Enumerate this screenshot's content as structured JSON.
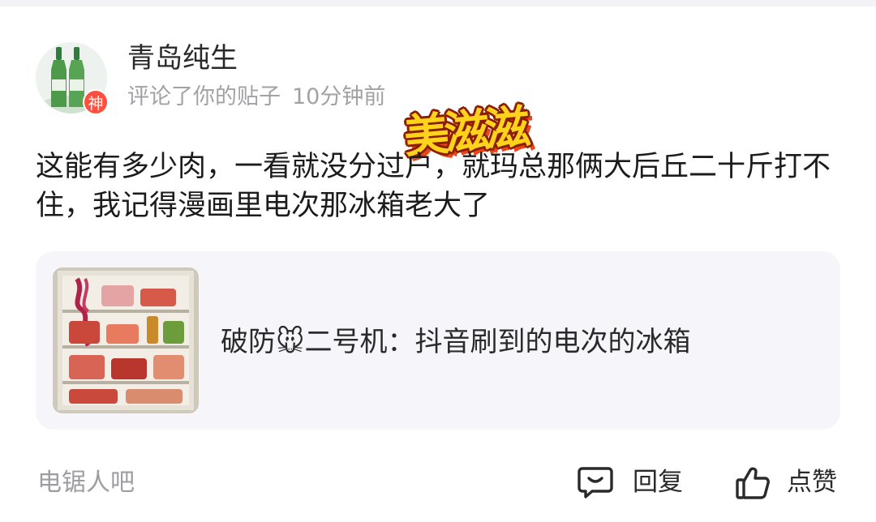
{
  "user": {
    "name": "青岛纯生",
    "badge": "神",
    "action_text": "评论了你的贴子",
    "time": "10分钟前"
  },
  "sticker": {
    "text": "美滋滋"
  },
  "comment": {
    "text": "这能有多少肉，一看就没分过户，就玛总那俩大后丘二十斤打不住，我记得漫画里电次那冰箱老大了"
  },
  "quoted_post": {
    "text": "破防🐭二号机：抖音刷到的电次的冰箱"
  },
  "footer": {
    "forum": "电锯人吧",
    "reply_label": "回复",
    "like_label": "点赞"
  },
  "colors": {
    "badge": "#ff4f3f",
    "card_bg": "#f6f5fa",
    "muted_text": "#a2a2a6",
    "sticker_fill": "#ffd31c",
    "sticker_outline": "#8b1e00"
  },
  "icons": {
    "reply": "comment-bubble-icon",
    "like": "thumbs-up-icon"
  }
}
